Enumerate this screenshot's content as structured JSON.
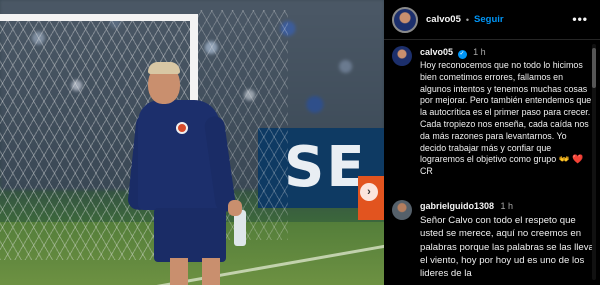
{
  "post": {
    "username": "calvo05",
    "follow_label": "Seguir",
    "more_label": "•••",
    "banner_text": "SE",
    "next_label": "›",
    "separator": "•"
  },
  "comments": [
    {
      "username": "calvo05",
      "verified": true,
      "time": "1 h",
      "text": "Hoy reconocemos que no todo lo hicimos bien cometimos errores, fallamos en algunos intentos y tenemos muchas cosas por mejorar. Pero también entendemos que la autocrítica es el primer paso para crecer. Cada tropiezo nos enseña, cada caída nos da más razones para levantarnos. Yo decido trabajar más y confiar que lograremos el objetivo como grupo",
      "emoji_a": "👐",
      "emoji_b": "❤️",
      "suffix": "CR"
    },
    {
      "username": "gabrielguido1308",
      "verified": false,
      "time": "1 h",
      "text": "Señor Calvo con todo el respeto que usted se merece, aquí no creemos en palabras porque las palabras se las lleva el viento, hoy por hoy ud es uno de los lideres de la"
    }
  ],
  "colors": {
    "background": "#000000",
    "text": "#f5f5f5",
    "muted": "#a8a8a8",
    "accent_blue": "#0095f6"
  },
  "icons": [
    "more-options-icon",
    "verified-badge-icon",
    "next-image-icon"
  ]
}
